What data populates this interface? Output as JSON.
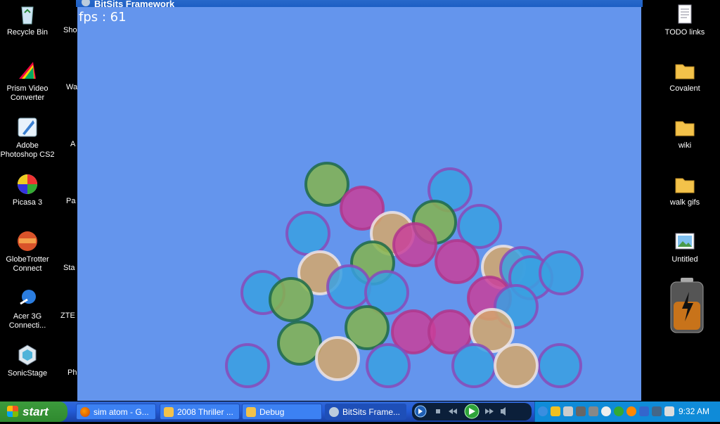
{
  "desktop_left": [
    {
      "label": "Recycle Bin",
      "icon": "recycle-bin-icon"
    },
    {
      "label": "Prism Video Converter",
      "icon": "prism-icon"
    },
    {
      "label": "Adobe Photoshop CS2",
      "icon": "photoshop-icon"
    },
    {
      "label": "Picasa 3",
      "icon": "picasa-icon"
    },
    {
      "label": "GlobeTrotter Connect",
      "icon": "globetrotter-icon"
    },
    {
      "label": "Acer 3G Connecti...",
      "icon": "acer-3g-icon"
    },
    {
      "label": "SonicStage",
      "icon": "sonicstage-icon"
    }
  ],
  "desktop_partial": [
    "Sho",
    "Wa",
    "A",
    "Pa",
    "Sta",
    "ZTE",
    "Ph"
  ],
  "desktop_right": [
    {
      "label": "TODO links",
      "icon": "text-file-icon"
    },
    {
      "label": "Covalent",
      "icon": "folder-icon"
    },
    {
      "label": "wiki",
      "icon": "folder-icon"
    },
    {
      "label": "walk gifs",
      "icon": "folder-icon"
    },
    {
      "label": "Untitled",
      "icon": "image-file-icon"
    }
  ],
  "window": {
    "title": "BitSits Framework",
    "fps_label": "fps : 61"
  },
  "canvas_bg": "#6495ed",
  "balls": [
    {
      "color": "green"
    },
    {
      "color": "pink"
    },
    {
      "color": "blue"
    },
    {
      "color": "blue"
    },
    {
      "color": "blue"
    },
    {
      "color": "orange"
    },
    {
      "color": "green"
    },
    {
      "color": "blue"
    },
    {
      "color": "pink"
    },
    {
      "color": "pink"
    },
    {
      "color": "orange"
    },
    {
      "color": "orange"
    },
    {
      "color": "green"
    },
    {
      "color": "blue"
    },
    {
      "color": "blue"
    },
    {
      "color": "blue"
    },
    {
      "color": "blue"
    },
    {
      "color": "green"
    },
    {
      "color": "pink"
    },
    {
      "color": "blue"
    },
    {
      "color": "green"
    },
    {
      "color": "pink"
    },
    {
      "color": "pink"
    },
    {
      "color": "green"
    },
    {
      "color": "orange"
    },
    {
      "color": "blue"
    },
    {
      "color": "orange"
    },
    {
      "color": "blue"
    },
    {
      "color": "blue"
    },
    {
      "color": "orange"
    },
    {
      "color": "blue"
    },
    {
      "color": "blue"
    }
  ],
  "ball_colors": {
    "blue": {
      "fill": "#3aa0e0",
      "ring": "#8a4ab8"
    },
    "pink": {
      "fill": "#c8409a",
      "ring": "#b0368c"
    },
    "green": {
      "fill": "#84b44e",
      "ring": "#1f6b4a"
    },
    "orange": {
      "fill": "#d6a86a",
      "ring": "#ece4e6"
    }
  },
  "taskbar": {
    "start_label": "start",
    "tasks": [
      {
        "label": "sim atom - G...",
        "icon": "firefox-icon"
      },
      {
        "label": "2008 Thriller ...",
        "icon": "folder-icon"
      },
      {
        "label": "Debug",
        "icon": "folder-icon"
      },
      {
        "label": "BitSits Frame...",
        "icon": "app-icon"
      }
    ],
    "clock": "9:32 AM"
  }
}
